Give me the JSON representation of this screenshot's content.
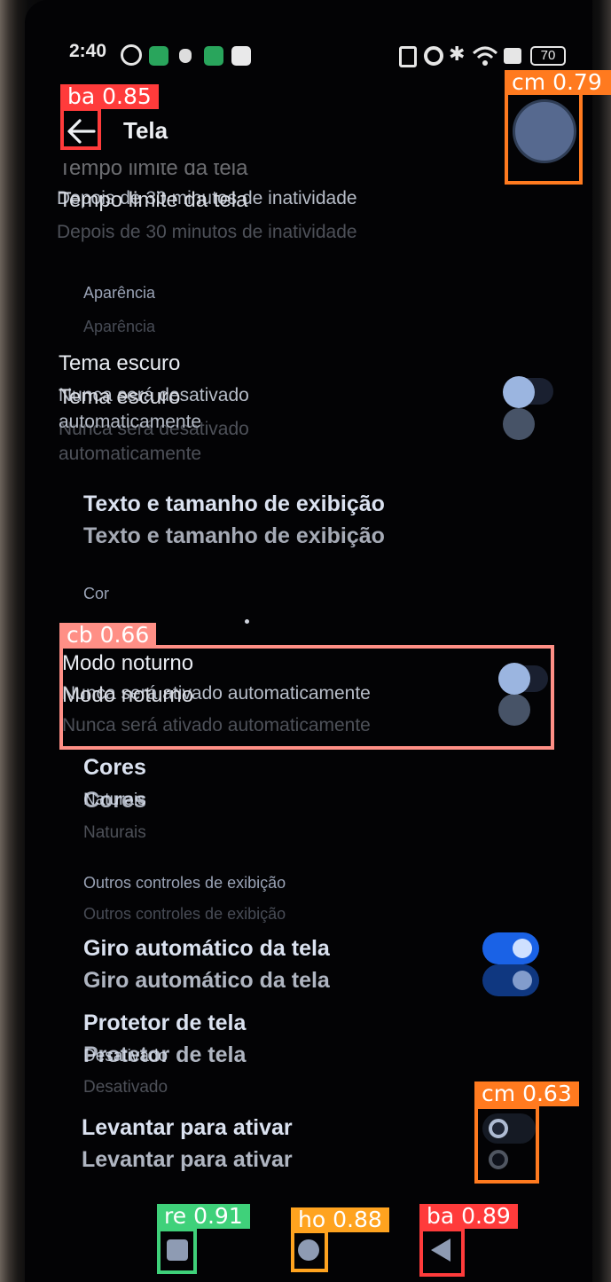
{
  "status_bar": {
    "time": "2:40",
    "battery": "70"
  },
  "header": {
    "title": "Tela"
  },
  "rows": {
    "timeout_title_ghost": "Tempo limite da tela",
    "timeout_title": "Tempo limite da tela",
    "timeout_sub": "Depois de 30 minutos de inatividade",
    "appearance_section": "Aparência",
    "dark_theme_title": "Tema escuro",
    "dark_theme_sub_line1": "Nunca será desativado",
    "dark_theme_sub_line2": "automaticamente",
    "text_size": "Texto e tamanho de exibição",
    "color_section": "Cor",
    "night_mode_title": "Modo noturno",
    "night_mode_sub": "Nunca será ativado automaticamente",
    "colors_title": "Cores",
    "colors_sub": "Naturais",
    "other_section": "Outros controles de exibição",
    "auto_rotate": "Giro automático da tela",
    "screensaver_title": "Protetor de tela",
    "screensaver_sub": "Desativado",
    "lift_to_wake": "Levantar para ativar"
  },
  "toggles": {
    "dark_theme": false,
    "night_mode": false,
    "auto_rotate": true,
    "lift_to_wake": false
  },
  "detections": [
    {
      "label": "ba",
      "score": "0.85",
      "color": "#ff3b3b"
    },
    {
      "label": "cm",
      "score": "0.79",
      "color": "#ff7a1f"
    },
    {
      "label": "cb",
      "score": "0.66",
      "color": "#ff8f86"
    },
    {
      "label": "cm",
      "score": "0.63",
      "color": "#ff7a1f"
    },
    {
      "label": "re",
      "score": "0.91",
      "color": "#3fd17a"
    },
    {
      "label": "ho",
      "score": "0.88",
      "color": "#ffa31f"
    },
    {
      "label": "ba",
      "score": "0.89",
      "color": "#ff3b3b"
    }
  ],
  "colors": {
    "accent": "#1a62e6",
    "knob_off": "#7f9ccc",
    "background": "#030305"
  },
  "icons": [
    "settings-icon",
    "grid-app-icon",
    "bug-icon",
    "android-icon",
    "app-icon",
    "nfc-icon",
    "alarm-icon",
    "bluetooth-icon",
    "wifi-icon",
    "data-off-icon",
    "battery-icon",
    "back-arrow-icon",
    "recents-icon",
    "home-icon",
    "back-triangle-icon"
  ]
}
